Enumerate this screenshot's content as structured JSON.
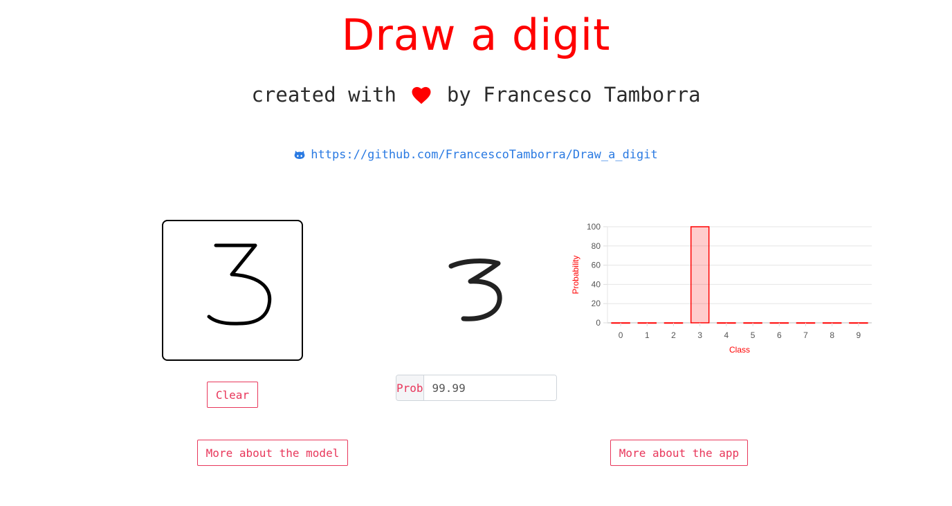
{
  "header": {
    "title": "Draw a digit",
    "subtitle_before": "created with",
    "subtitle_after": "by Francesco Tamborra",
    "repo_url": "https://github.com/FrancescoTamborra/Draw_a_digit"
  },
  "canvas": {
    "drawn_digit": "3",
    "clear_label": "Clear"
  },
  "prediction": {
    "digit": "3",
    "prob_prefix": "Prob",
    "prob_value": "99.99",
    "prob_suffix": "%"
  },
  "links": {
    "model_label": "More about the model",
    "app_label": "More about the app"
  },
  "colors": {
    "accent": "#ff0000",
    "button": "#e8365a",
    "link": "#2a7ae2",
    "bar_fill": "rgba(255,0,0,0.2)"
  },
  "icons": {
    "heart": "heart-icon",
    "github": "github-icon"
  },
  "chart_data": {
    "type": "bar",
    "categories": [
      "0",
      "1",
      "2",
      "3",
      "4",
      "5",
      "6",
      "7",
      "8",
      "9"
    ],
    "values": [
      0,
      0,
      0,
      99.99,
      0,
      0,
      0,
      0,
      0,
      0
    ],
    "xlabel": "Class",
    "ylabel": "Probability",
    "ylim": [
      0,
      100
    ],
    "yticks": [
      0,
      20,
      40,
      60,
      80,
      100
    ],
    "grid": true,
    "legend": "none"
  }
}
